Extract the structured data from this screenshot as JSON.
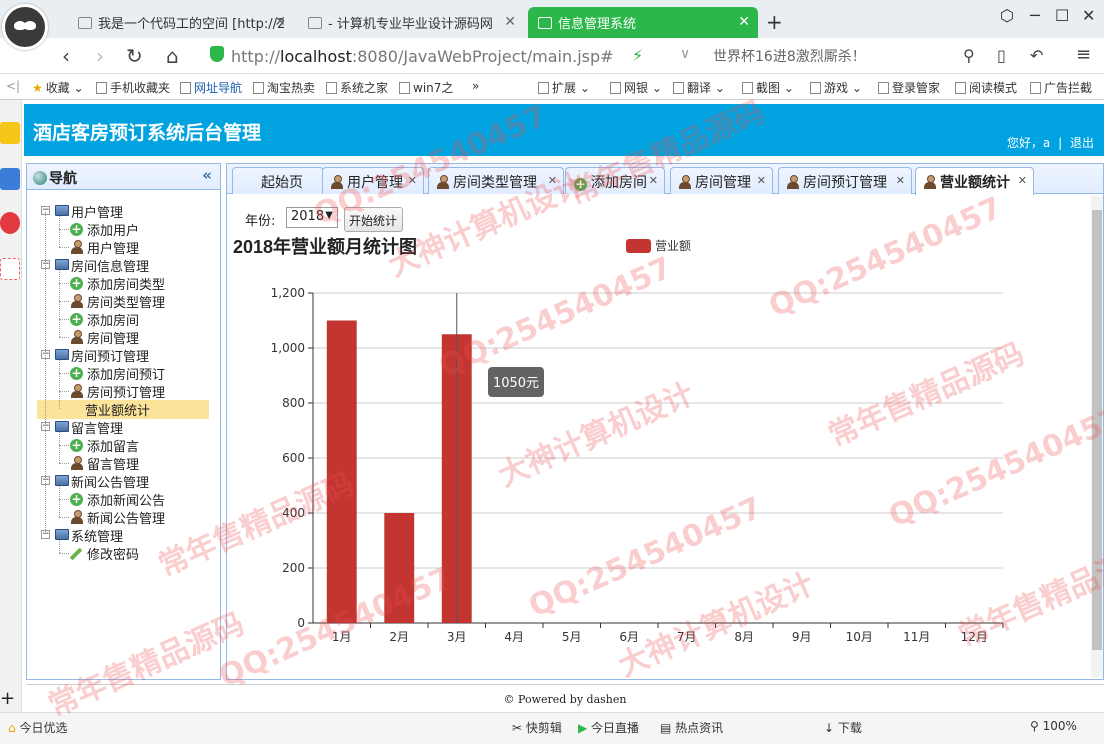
{
  "browser": {
    "tabs": [
      {
        "title": "我是一个代码工的空间 [http://2"
      },
      {
        "title": "- 计算机专业毕业设计源码网"
      },
      {
        "title": "信息管理系统"
      }
    ],
    "url_prefix": "http://",
    "url_host": "localhost",
    "url_rest": ":8080/JavaWebProject/main.jsp#",
    "search_hint": "世界杯16进8激烈厮杀！",
    "bookmarks": [
      "收藏",
      "手机收藏夹",
      "网址导航",
      "淘宝热卖",
      "系统之家",
      "win7之",
      "»",
      "扩展",
      "网银",
      "翻译",
      "截图",
      "游戏",
      "登录管家",
      "阅读模式",
      "广告拦截"
    ]
  },
  "app": {
    "title": "酒店客房预订系统后台管理",
    "greeting": "您好，a",
    "sep": "|",
    "logout": "退出"
  },
  "nav": {
    "title": "导航",
    "collapse": "«",
    "groups": [
      {
        "label": "用户管理",
        "items": [
          {
            "label": "添加用户",
            "icon": "plus"
          },
          {
            "label": "用户管理",
            "icon": "user"
          }
        ]
      },
      {
        "label": "房间信息管理",
        "items": [
          {
            "label": "添加房间类型",
            "icon": "plus"
          },
          {
            "label": "房间类型管理",
            "icon": "user"
          },
          {
            "label": "添加房间",
            "icon": "plus"
          },
          {
            "label": "房间管理",
            "icon": "user"
          }
        ]
      },
      {
        "label": "房间预订管理",
        "items": [
          {
            "label": "添加房间预订",
            "icon": "plus"
          },
          {
            "label": "房间预订管理",
            "icon": "user"
          },
          {
            "label": "营业额统计",
            "icon": "user",
            "selected": true
          }
        ]
      },
      {
        "label": "留言管理",
        "items": [
          {
            "label": "添加留言",
            "icon": "plus"
          },
          {
            "label": "留言管理",
            "icon": "user"
          }
        ]
      },
      {
        "label": "新闻公告管理",
        "items": [
          {
            "label": "添加新闻公告",
            "icon": "plus"
          },
          {
            "label": "新闻公告管理",
            "icon": "user"
          }
        ]
      },
      {
        "label": "系统管理",
        "items": [
          {
            "label": "修改密码",
            "icon": "pencil"
          }
        ]
      }
    ]
  },
  "main_tabs": [
    {
      "label": "起始页",
      "icon": "",
      "closable": false
    },
    {
      "label": "用户管理",
      "icon": "user",
      "closable": true
    },
    {
      "label": "房间类型管理",
      "icon": "user",
      "closable": true
    },
    {
      "label": "添加房间",
      "icon": "plus",
      "closable": true
    },
    {
      "label": "房间管理",
      "icon": "user",
      "closable": false
    },
    {
      "label": "房间预订管理",
      "icon": "user",
      "closable": true
    },
    {
      "label": "营业额统计",
      "icon": "user",
      "closable": true,
      "active": true
    }
  ],
  "filter": {
    "year_label": "年份:",
    "year_value": "2018",
    "start_button": "开始统计"
  },
  "chart_data": {
    "type": "bar",
    "title": "2018年营业额月统计图",
    "categories": [
      "1月",
      "2月",
      "3月",
      "4月",
      "5月",
      "6月",
      "7月",
      "8月",
      "9月",
      "10月",
      "11月",
      "12月"
    ],
    "series": [
      {
        "name": "营业额",
        "values": [
          1100,
          400,
          1050,
          0,
          0,
          0,
          0,
          0,
          0,
          0,
          0,
          0
        ],
        "color": "#c23531"
      }
    ],
    "ylim": [
      0,
      1200
    ],
    "yticks": [
      "0",
      "200",
      "400",
      "600",
      "800",
      "1,000",
      "1,200"
    ],
    "grid": true,
    "legend": "top-center",
    "tooltip": "1050元"
  },
  "footer": "© Powered by dashen",
  "statusbar": [
    "今日优选",
    "快剪辑",
    "今日直播",
    "热点资讯",
    "下载",
    "100%"
  ],
  "watermarks": [
    "QQ:254540457",
    "常年售精品源码",
    "大神计算机设计"
  ]
}
